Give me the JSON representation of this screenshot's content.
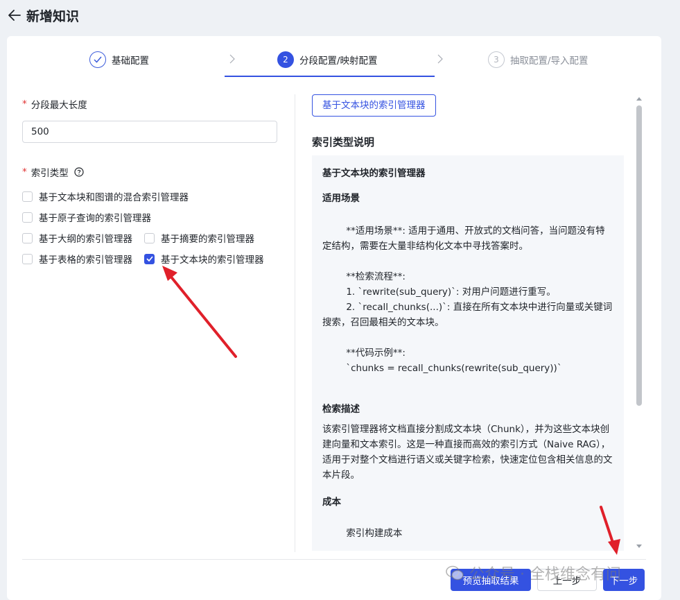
{
  "header": {
    "title": "新增知识"
  },
  "steps": [
    {
      "number": "1",
      "label": "基础配置",
      "status": "done"
    },
    {
      "number": "2",
      "label": "分段配置/映射配置",
      "status": "active"
    },
    {
      "number": "3",
      "label": "抽取配置/导入配置",
      "status": "pending"
    }
  ],
  "form": {
    "max_length_label": "分段最大长度",
    "max_length_value": "500",
    "index_type_label": "索引类型",
    "options": [
      {
        "label": "基于文本块和图谱的混合索引管理器",
        "checked": false
      },
      {
        "label": "基于原子查询的索引管理器",
        "checked": false
      },
      {
        "label": "基于大纲的索引管理器",
        "checked": false
      },
      {
        "label": "基于摘要的索引管理器",
        "checked": false
      },
      {
        "label": "基于表格的索引管理器",
        "checked": false
      },
      {
        "label": "基于文本块的索引管理器",
        "checked": true
      }
    ]
  },
  "panel": {
    "selected_tag": "基于文本块的索引管理器",
    "section_title": "索引类型说明",
    "desc_heading": "基于文本块的索引管理器",
    "scene_heading": "适用场景",
    "scene_text_1": "        **适用场景**: 适用于通用、开放式的文档问答，当问题没有特定结构，需要在大量非结构化文本中寻找答案时。",
    "flow_title": "        **检索流程**:",
    "flow_1": "        1. `rewrite(sub_query)`: 对用户问题进行重写。",
    "flow_2": "        2. `recall_chunks(...)`: 直接在所有文本块中进行向量或关键词搜索，召回最相关的文本块。",
    "code_title": "        **代码示例**:",
    "code_line": "        `chunks = recall_chunks(rewrite(sub_query))`",
    "retrieval_heading": "检索描述",
    "retrieval_text": "该索引管理器将文档直接分割成文本块（Chunk），并为这些文本块创建向量和文本索引。这是一种直接而高效的索引方式（Naive RAG），适用于对整个文档进行语义或关键字检索，快速定位包含相关信息的文本片段。",
    "cost_heading": "成本",
    "cost_partial": "        索引构建成本"
  },
  "footer": {
    "preview_label": "预览抽取结果",
    "prev_label": "上一步",
    "next_label": "下一步"
  },
  "watermark": {
    "text": "公众号 · 全栈维念有问"
  },
  "colors": {
    "primary": "#3452e1",
    "arrow": "#e0202a",
    "required": "#e03131"
  }
}
